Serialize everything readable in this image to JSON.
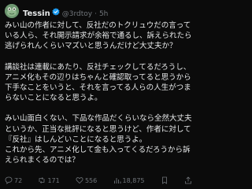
{
  "tweet": {
    "author": {
      "name": "Tessin",
      "handle": "@3rdtoy",
      "dot": "·",
      "time": "5h",
      "verified": true
    },
    "paragraphs": [
      "みい山の作者に対して、反社だのトクリュウだの言っている人ら、それ開示請求が余裕で通るし、訴えられたら逃げられんくらいマズいと思うんだけど大丈夫か？",
      "講談社は連載にあたり、反社チェックしてるだろうし、アニメ化もその辺りはちゃんと確認取ってると思うから下手なことをいうと、それを言ってる人らの人生がつまらないことになると思うよ。",
      "みい山面白くない、下品な作品だくらいなら全然大丈夫というか、正当な批評になると思うけど、作者に対して『反社』はしんどいことになると思うよ。\nこれから先、アニメ化して金も入ってくるだろうから訴えられまくるのでは？"
    ],
    "actions": {
      "replies": "72",
      "retweets": "171",
      "likes": "556",
      "views": "18,875"
    },
    "icons": {
      "avatar": "frog-avatar",
      "verified": "verified-badge-icon",
      "reply": "reply-icon",
      "retweet": "retweet-icon",
      "like": "heart-icon",
      "views": "views-icon",
      "bookmark": "bookmark-icon",
      "share": "share-icon"
    },
    "colors": {
      "background": "#0b0b0b",
      "text": "#e7e9ea",
      "muted": "#71767b",
      "verified": "#1d9bf0"
    }
  }
}
